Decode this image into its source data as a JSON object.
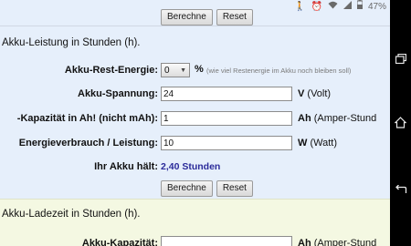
{
  "status_bar": {
    "battery_text": "47%",
    "icons": [
      "person-icon",
      "alarm-icon",
      "wifi-icon",
      "signal-icon",
      "battery-icon"
    ]
  },
  "top_buttons": {
    "calc": "Berechne",
    "reset": "Reset"
  },
  "section1": {
    "title": "Akku-Leistung in Stunden (h).",
    "rest_energy": {
      "label": "Akku-Rest-Energie:",
      "value": "0",
      "unit": "%",
      "hint": "(wie viel Restenergie im Akku noch bleiben soll)"
    },
    "voltage": {
      "label": "Akku-Spannung:",
      "value": "24",
      "unit_bold": "V",
      "unit_rest": " (Volt)"
    },
    "capacity": {
      "label": "-Kapazität in Ah! (nicht mAh):",
      "value": "1",
      "unit_bold": "Ah",
      "unit_rest": " (Amper-Stund"
    },
    "consumption": {
      "label": "Energieverbrauch / Leistung:",
      "value": "10",
      "unit_bold": "W",
      "unit_rest": " (Watt)"
    },
    "result": {
      "label": "Ihr Akku hält:",
      "value": "2,40 Stunden"
    },
    "buttons": {
      "calc": "Berechne",
      "reset": "Reset"
    }
  },
  "section2": {
    "title": "Akku-Ladezeit in Stunden (h).",
    "capacity": {
      "label": "Akku-Kapazität:",
      "value": "",
      "unit_bold": "Ah",
      "unit_rest": " (Amper-Stund"
    }
  },
  "colors": {
    "section1_bg": "#e6effb",
    "section2_bg": "#f4f8e2",
    "result_text": "#2b2b9a",
    "navbar_bg": "#000000"
  }
}
